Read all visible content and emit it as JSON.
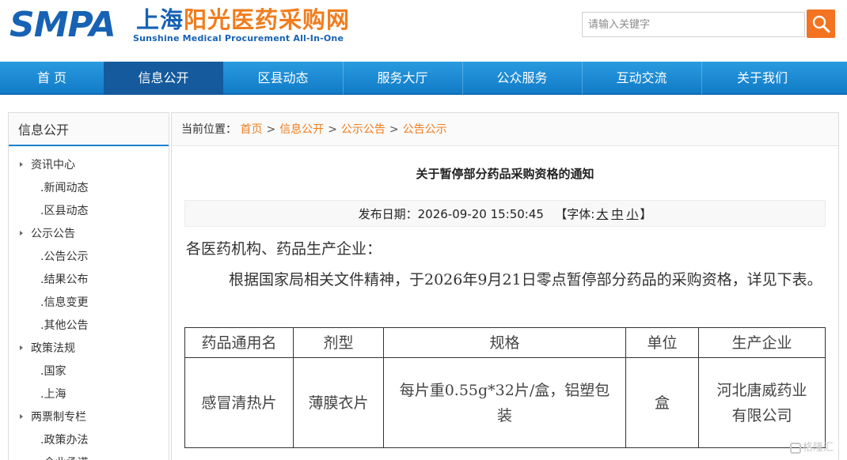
{
  "site": {
    "logo_abbr": "SMPA",
    "logo_cn_a": "上海",
    "logo_cn_b": "阳光医药采购网",
    "logo_en": "Sunshine Medical Procurement All-In-One"
  },
  "search": {
    "placeholder": "请输入关键字",
    "button_icon": "search-icon"
  },
  "nav": {
    "items": [
      {
        "label": "首 页"
      },
      {
        "label": "信息公开",
        "active": true
      },
      {
        "label": "区县动态"
      },
      {
        "label": "服务大厅"
      },
      {
        "label": "公众服务"
      },
      {
        "label": "互动交流"
      },
      {
        "label": "关于我们"
      }
    ]
  },
  "sidebar": {
    "title": "信息公开",
    "items": [
      {
        "label": "资讯中心",
        "type": "cat"
      },
      {
        "label": ".新闻动态",
        "type": "sub"
      },
      {
        "label": ".区县动态",
        "type": "sub"
      },
      {
        "label": "公示公告",
        "type": "cat"
      },
      {
        "label": ".公告公示",
        "type": "sub"
      },
      {
        "label": ".结果公布",
        "type": "sub"
      },
      {
        "label": ".信息变更",
        "type": "sub"
      },
      {
        "label": ".其他公告",
        "type": "sub"
      },
      {
        "label": "政策法规",
        "type": "cat"
      },
      {
        "label": ".国家",
        "type": "sub"
      },
      {
        "label": ".上海",
        "type": "sub"
      },
      {
        "label": "两票制专栏",
        "type": "cat"
      },
      {
        "label": ".政策办法",
        "type": "sub"
      },
      {
        "label": ".企业承诺",
        "type": "sub"
      }
    ]
  },
  "breadcrumb": {
    "prefix": "当前位置：",
    "items": [
      "首页",
      "信息公开",
      "公示公告",
      "公告公示"
    ],
    "separator": ">"
  },
  "article": {
    "title": "关于暂停部分药品采购资格的通知",
    "date_label": "发布日期：",
    "date": "2026-09-20 15:50:45",
    "font_label": "【字体:",
    "font_large": "大",
    "font_medium": "中",
    "font_small": "小",
    "font_close": "】",
    "salutation": "各医药机构、药品生产企业：",
    "body": "根据国家局相关文件精神，于2026年9月21日零点暂停部分药品的采购资格，详见下表。"
  },
  "table": {
    "headers": [
      "药品通用名",
      "剂型",
      "规格",
      "单位",
      "生产企业"
    ],
    "rows": [
      [
        "感冒清热片",
        "薄膜衣片",
        "每片重0.55g*32片/盒，铝塑包装",
        "盒",
        "河北唐威药业有限公司"
      ]
    ]
  },
  "watermark": {
    "text": "格隆汇"
  },
  "colors": {
    "brand_blue": "#1762b4",
    "accent_orange": "#f37321",
    "nav_blue": "#1a88d4",
    "nav_active": "#145a9c"
  }
}
